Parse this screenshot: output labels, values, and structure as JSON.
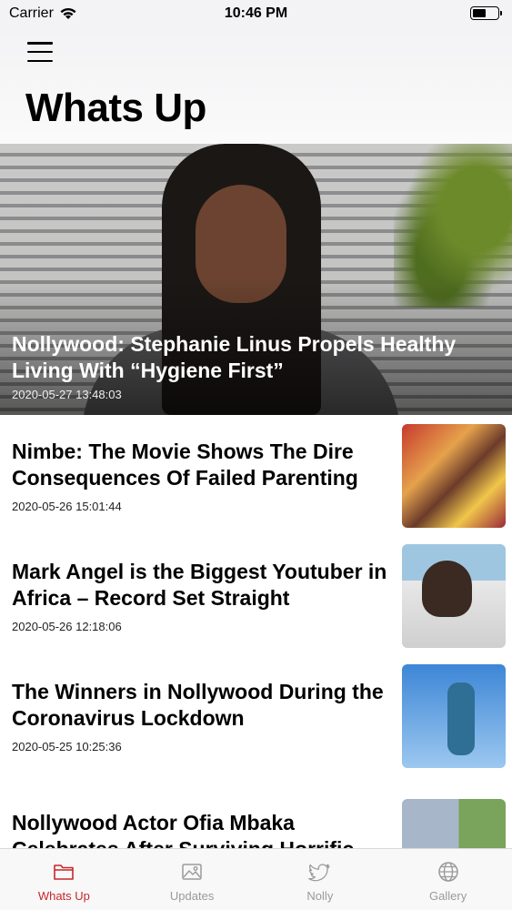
{
  "status_bar": {
    "carrier": "Carrier",
    "time": "10:46 PM"
  },
  "header": {
    "title": "Whats Up",
    "menu_icon": "hamburger-menu-icon"
  },
  "featured": {
    "title": "Nollywood: Stephanie Linus Propels Healthy Living With “Hygiene First”",
    "date": "2020-05-27 13:48:03"
  },
  "news": [
    {
      "title": "Nimbe: The Movie Shows The Dire Consequences Of Failed Parenting",
      "date": "2020-05-26 15:01:44"
    },
    {
      "title": "Mark Angel is the Biggest Youtuber in Africa – Record Set Straight",
      "date": "2020-05-26 12:18:06"
    },
    {
      "title": "The Winners in Nollywood During the Coronavirus Lockdown",
      "date": "2020-05-25 10:25:36"
    },
    {
      "title": "Nollywood Actor Ofia Mbaka Celebrates After Surviving Horrific",
      "date": ""
    }
  ],
  "tabs": [
    {
      "label": "Whats Up",
      "icon": "folder-icon",
      "active": true
    },
    {
      "label": "Updates",
      "icon": "image-icon",
      "active": false
    },
    {
      "label": "Nolly",
      "icon": "twitter-bird-icon",
      "active": false
    },
    {
      "label": "Gallery",
      "icon": "globe-icon",
      "active": false
    }
  ],
  "colors": {
    "accent": "#c8262b",
    "inactive_tab": "#9a9a9a"
  }
}
